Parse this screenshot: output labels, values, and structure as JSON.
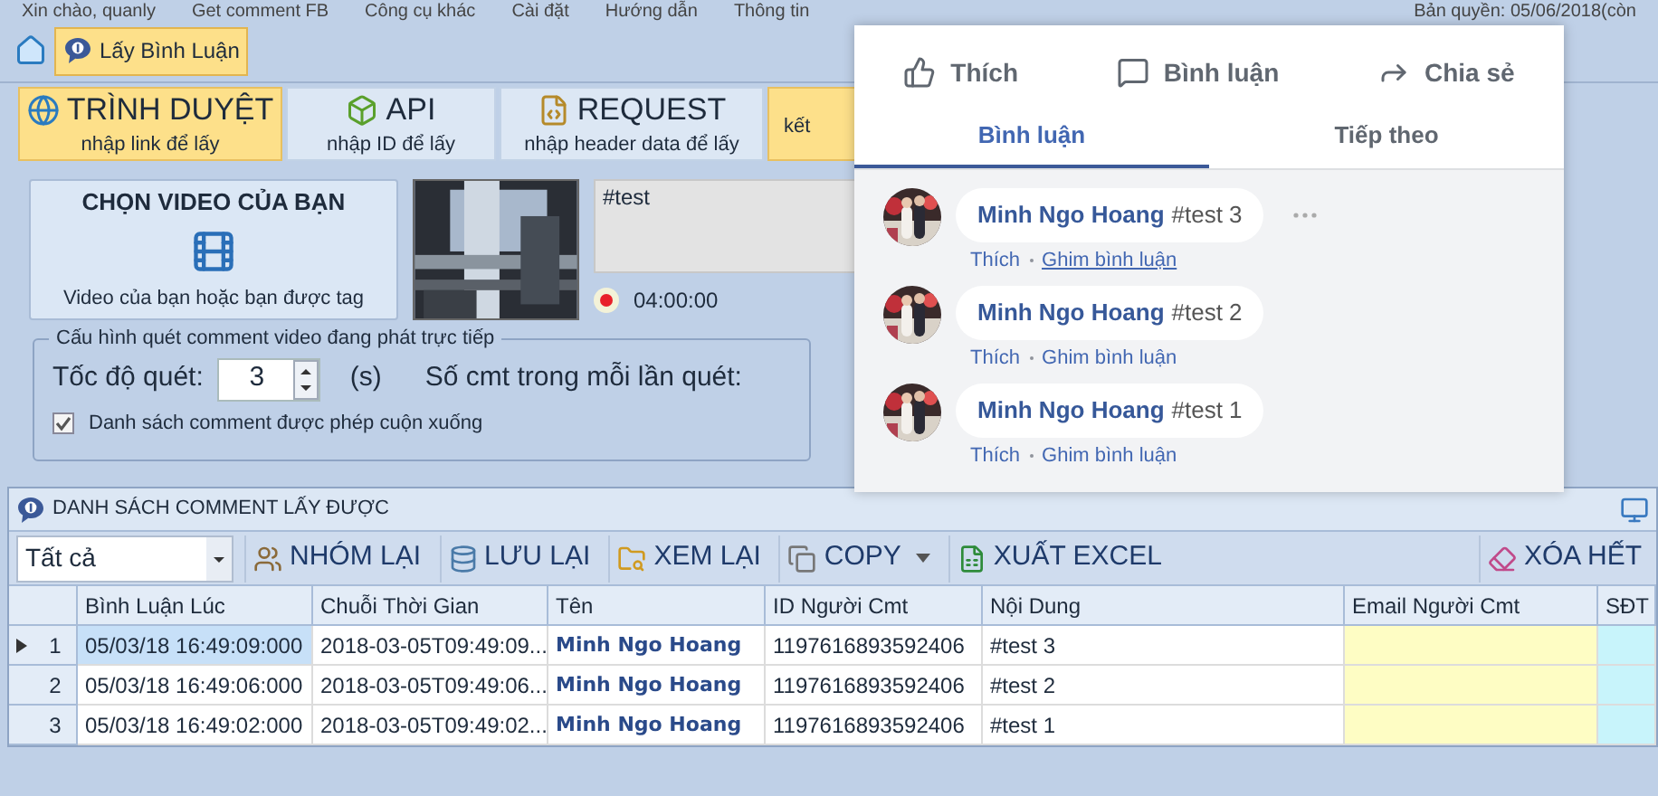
{
  "top_menu": [
    {
      "label": "Xin chào, quanly"
    },
    {
      "label": "Get comment FB"
    },
    {
      "label": "Công cụ khác"
    },
    {
      "label": "Cài đặt"
    },
    {
      "label": "Hướng dẫn"
    },
    {
      "label": "Thông tin"
    }
  ],
  "copyright": "Bản quyền: 05/06/2018(còn",
  "quick_tabs": [
    {
      "label": "Lấy Bình Luận",
      "selected": true
    }
  ],
  "modes": [
    {
      "title": "TRÌNH DUYỆT",
      "subtitle": "nhập link để lấy",
      "kind": "browser",
      "selected": true
    },
    {
      "title": "API",
      "subtitle": "nhập ID để lấy",
      "kind": "api",
      "selected": false
    },
    {
      "title": "REQUEST",
      "subtitle": "nhập header data để lấy",
      "kind": "request",
      "selected": false
    },
    {
      "subtitle": "kết",
      "kind": "other",
      "selected": true
    }
  ],
  "video": {
    "title": "CHỌN VIDEO CỦA BẠN",
    "caption": "Video của bạn hoặc bạn được tag",
    "message": "#test",
    "recording": true,
    "duration": "04:00:00"
  },
  "scan_config": {
    "legend": "Cấu hình quét comment video đang phát trực tiếp",
    "speed_label": "Tốc độ quét:",
    "speed_value": "3",
    "speed_unit": "(s)",
    "count_label": "Số cmt trong mỗi lần quét:",
    "allow_scroll": {
      "label": "Danh sách comment được phép cuộn xuống",
      "checked": true
    }
  },
  "comments_panel": {
    "title": "DANH SÁCH COMMENT LẤY ĐƯỢC",
    "filter": "Tất cả",
    "toolbar": [
      {
        "label": "NHÓM LẠI",
        "kind": "group"
      },
      {
        "label": "LƯU LẠI",
        "kind": "save"
      },
      {
        "label": "XEM LẠI",
        "kind": "view"
      },
      {
        "label": "COPY",
        "kind": "copy",
        "has_menu": true
      },
      {
        "label": "XUẤT EXCEL",
        "kind": "excel"
      },
      {
        "label": "XÓA HẾT",
        "kind": "clear"
      }
    ],
    "columns": [
      {
        "label": "Bình Luận Lúc",
        "kind": "text"
      },
      {
        "label": "Chuỗi Thời Gian",
        "kind": "text"
      },
      {
        "label": "Tên",
        "kind": "name"
      },
      {
        "label": "ID Người Cmt",
        "kind": "text"
      },
      {
        "label": "Nội Dung",
        "kind": "text"
      },
      {
        "label": "Email Người Cmt",
        "kind": "email"
      },
      {
        "label": "SĐT",
        "kind": "phone"
      }
    ],
    "rows": [
      {
        "index": "1",
        "selected": true,
        "cells": [
          "05/03/18 16:49:09:000",
          "2018-03-05T09:49:09...",
          "Minh Ngo Hoang",
          "1197616893592406",
          "#test 3"
        ]
      },
      {
        "index": "2",
        "selected": false,
        "cells": [
          "05/03/18 16:49:06:000",
          "2018-03-05T09:49:06...",
          "Minh Ngo Hoang",
          "1197616893592406",
          "#test 2"
        ]
      },
      {
        "index": "3",
        "selected": false,
        "cells": [
          "05/03/18 16:49:02:000",
          "2018-03-05T09:49:02...",
          "Minh Ngo Hoang",
          "1197616893592406",
          "#test 1"
        ]
      }
    ]
  },
  "facebook_overlay": {
    "actions": [
      {
        "label": "Thích",
        "kind": "like"
      },
      {
        "label": "Bình luận",
        "kind": "comment"
      },
      {
        "label": "Chia sẻ",
        "kind": "share"
      }
    ],
    "tabs": [
      {
        "label": "Bình luận",
        "selected": true
      },
      {
        "label": "Tiếp theo",
        "selected": false
      }
    ],
    "comments": [
      {
        "author": "Minh Ngo Hoang",
        "text": "#test 3",
        "like": "Thích",
        "pin": "Ghim bình luận",
        "hovered": true
      },
      {
        "author": "Minh Ngo Hoang",
        "text": "#test 2",
        "like": "Thích",
        "pin": "Ghim bình luận",
        "hovered": false
      },
      {
        "author": "Minh Ngo Hoang",
        "text": "#test 1",
        "like": "Thích",
        "pin": "Ghim bình luận",
        "hovered": false
      }
    ]
  }
}
